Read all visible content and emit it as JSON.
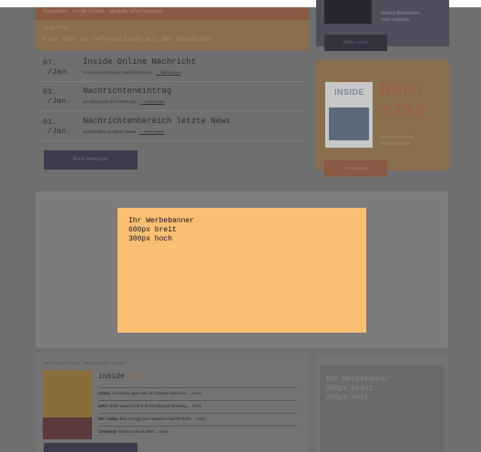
{
  "header": {
    "red_bar_text": "Redaktion · Inside Online · aktuelle Informationen",
    "orange_small": "Inside Online",
    "orange_text": "Hier gibt es Informationen aus der Redaktion"
  },
  "news": [
    {
      "date": "07.\n /Jan.",
      "title": "Inside Online Nachricht",
      "subtitle": "So sehen jetzt neuen Nachrichten aus",
      "link": "... mehr lesen"
    },
    {
      "date": "03.\n /Jan.",
      "title": "Nachrichteneintrag",
      "subtitle": "So sehen jetzt hier Notes aus",
      "link": "... mehr lesen"
    },
    {
      "date": "01.\n /Jan.",
      "title": "Nachrichtenbereich letzte News",
      "subtitle": "Subheadline zu diesen News",
      "link": "... mehr lesen"
    }
  ],
  "older_button": "Ältere Meldungen",
  "sidebar": {
    "author_text_1": "Markus Barnhoeller",
    "author_text_2": "mehr erfahren",
    "more_button": "Weiter lesen",
    "magazine_logo": "INSIDE",
    "new_title": "Neu!",
    "new_issue": "#792",
    "new_sub_1": "Die neue Inside",
    "new_sub_2": "Magazin lesen",
    "issue_button": "zur Ausgabe"
  },
  "banner": {
    "text": "Ihr Werbebanner\n600px breit\n300px hoch"
  },
  "international": {
    "label": "INTERNATIONAL BEVERAGE NEWS",
    "title_prefix": "inside",
    "title_suffix": " beer",
    "rows": [
      {
        "country": "China:",
        "text": "Heineken eyes sale of Chinese business ... more"
      },
      {
        "country": "USA:",
        "text": "Bank takes control of Smuttynose Brewing ... more"
      },
      {
        "country": "UK / India:",
        "text": "Bira Energy and Heineken benefit from ... more"
      },
      {
        "country": "Germany:",
        "text": "Rumors about BBB ... more"
      }
    ]
  },
  "side_ad": {
    "text": "Ihr Werbebanner\n300px breit\n250px hoch"
  }
}
